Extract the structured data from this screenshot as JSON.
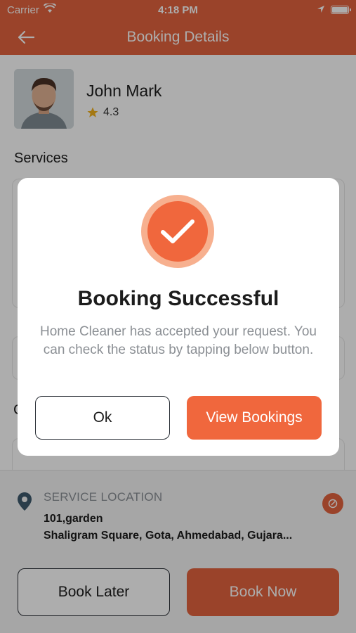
{
  "status_bar": {
    "carrier": "Carrier",
    "time": "4:18 PM"
  },
  "header": {
    "title": "Booking Details"
  },
  "provider": {
    "name": "John Mark",
    "rating": "4.3"
  },
  "services": {
    "title": "Services"
  },
  "hidden_section_initial": "C",
  "location": {
    "label": "SERVICE LOCATION",
    "line1": "101,garden",
    "line2": "Shaligram Square, Gota, Ahmedabad, Gujara..."
  },
  "actions": {
    "book_later": "Book Later",
    "book_now": "Book Now"
  },
  "modal": {
    "title": "Booking Successful",
    "message": "Home Cleaner has accepted your request. You can check the status by tapping below button.",
    "ok_label": "Ok",
    "view_label": "View Bookings"
  },
  "colors": {
    "accent": "#e4643e",
    "accent_light": "#f7b08f"
  },
  "icons": {
    "back": "arrow-left-icon",
    "star": "star-icon",
    "pin": "location-pin-icon",
    "edit": "edit-icon",
    "check": "check-icon"
  }
}
